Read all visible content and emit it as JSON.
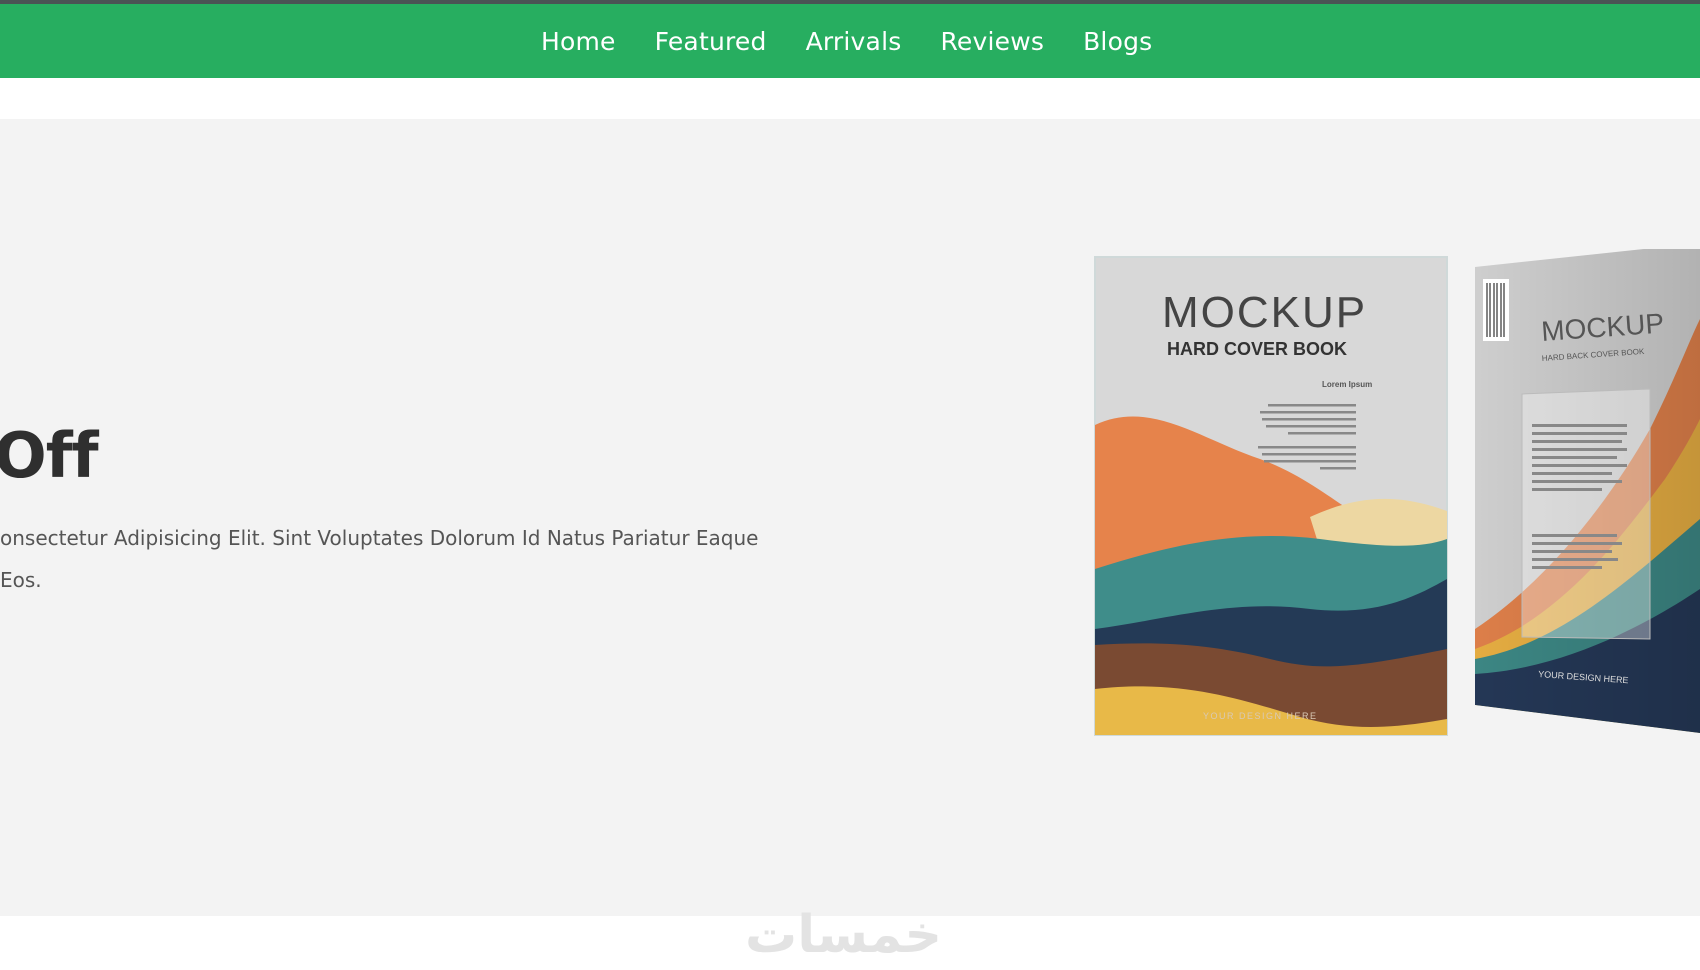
{
  "nav": {
    "items": [
      {
        "label": "Home"
      },
      {
        "label": "Featured"
      },
      {
        "label": "Arrivals"
      },
      {
        "label": "Reviews"
      },
      {
        "label": "Blogs"
      }
    ]
  },
  "hero": {
    "title": "Off",
    "text_line1": "onsectetur Adipisicing Elit. Sint Voluptates Dolorum Id Natus Pariatur Eaque",
    "text_line2": "Eos."
  },
  "book_front": {
    "title": "MOCKUP",
    "subtitle": "HARD COVER BOOK",
    "small_heading": "Lorem Ipsum",
    "footer": "YOUR DESIGN HERE"
  },
  "book_back": {
    "title": "MOCKUP",
    "subtitle": "HARD BACK COVER BOOK",
    "footer": "YOUR DESIGN HERE"
  },
  "watermark": "خمسات",
  "colors": {
    "nav_bg": "#27ae60",
    "hero_bg": "#f3f3f3",
    "title": "#2f2f2f"
  }
}
